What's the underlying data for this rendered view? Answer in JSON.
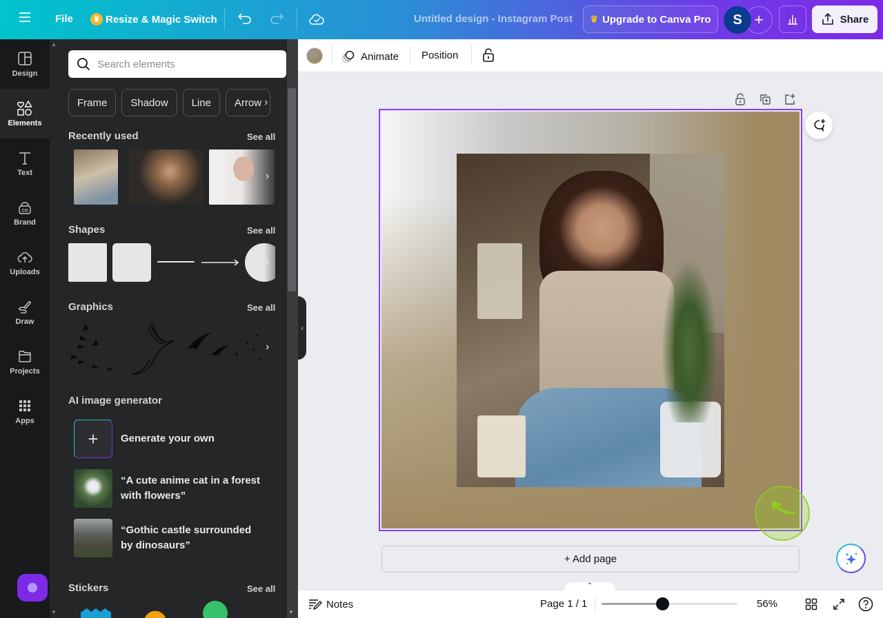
{
  "topbar": {
    "menu_icon": "hamburger-icon",
    "file_label": "File",
    "resize_label": "Resize & Magic Switch",
    "design_title": "Untitled design - Instagram Post",
    "upgrade_label": "Upgrade to Canva Pro",
    "avatar_initial": "S",
    "add_member_label": "+",
    "share_label": "Share"
  },
  "rail": {
    "items": [
      {
        "label": "Design",
        "icon": "layout-icon"
      },
      {
        "label": "Elements",
        "icon": "shapes-icon",
        "active": true
      },
      {
        "label": "Text",
        "icon": "text-icon"
      },
      {
        "label": "Brand",
        "icon": "brand-icon"
      },
      {
        "label": "Uploads",
        "icon": "cloud-upload-icon"
      },
      {
        "label": "Draw",
        "icon": "draw-icon"
      },
      {
        "label": "Projects",
        "icon": "folder-icon"
      },
      {
        "label": "Apps",
        "icon": "apps-grid-icon"
      }
    ]
  },
  "panel": {
    "search_placeholder": "Search elements",
    "chips": [
      "Frame",
      "Shadow",
      "Line",
      "Arrow"
    ],
    "sections": {
      "recently_used": {
        "title": "Recently used",
        "see_all": "See all"
      },
      "shapes": {
        "title": "Shapes",
        "see_all": "See all"
      },
      "graphics": {
        "title": "Graphics",
        "see_all": "See all"
      },
      "ai_generator": {
        "title": "AI image generator"
      },
      "stickers": {
        "title": "Stickers",
        "see_all": "See all"
      }
    },
    "ai_items": [
      {
        "label": "Generate your own"
      },
      {
        "label": "“A cute anime cat in a forest with flowers”"
      },
      {
        "label": "“Gothic castle surrounded by dinosaurs”"
      }
    ]
  },
  "context_bar": {
    "color_swatch": "#a08a64",
    "animate_label": "Animate",
    "position_label": "Position"
  },
  "canvas": {
    "selection_color": "#8b3dff",
    "add_page_label": "+ Add page"
  },
  "footer": {
    "notes_label": "Notes",
    "page_label": "Page 1 / 1",
    "zoom_value": 56,
    "zoom_label": "56%",
    "zoom_fraction": 0.45
  },
  "colors": {
    "accent_purple": "#7d2ae8",
    "accent_teal": "#00c4cc",
    "cursor_highlight": "#8fcc1e"
  }
}
